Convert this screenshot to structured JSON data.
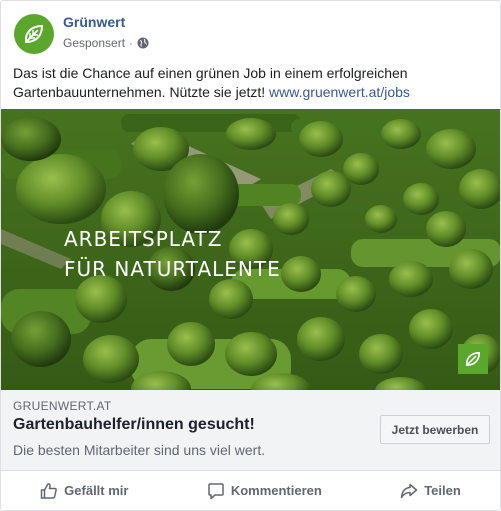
{
  "page": {
    "name": "Grünwert",
    "sponsored": "Gesponsert",
    "separator": "·"
  },
  "post": {
    "text": "Das ist die Chance auf einen grünen Job in einem erfolgreichen Gartenbauunternehmen. Nützte sie jetzt!",
    "link": "www.gruenwert.at/jobs"
  },
  "image": {
    "overlay_line1": "ARBEITSPLATZ",
    "overlay_line2": "FÜR NATURTALENTE"
  },
  "link_preview": {
    "domain": "GRUENWERT.AT",
    "headline": "Gartenbauhelfer/innen gesucht!",
    "description": "Die besten Mitarbeiter sind uns viel wert.",
    "cta_label": "Jetzt bewerben"
  },
  "actions": {
    "like": "Gefällt mir",
    "comment": "Kommentieren",
    "share": "Teilen"
  },
  "colors": {
    "brand_green": "#5aa72b",
    "link_blue": "#385898"
  },
  "icons": {
    "avatar": "leaf-icon",
    "privacy": "globe-icon",
    "like": "thumbs-up-icon",
    "comment": "comment-icon",
    "share": "share-icon"
  }
}
